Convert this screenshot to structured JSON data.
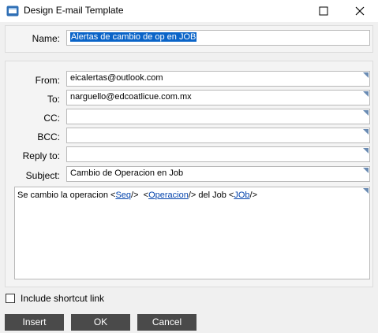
{
  "window": {
    "title": "Design E-mail Template"
  },
  "name": {
    "label": "Name:",
    "value": "Alertas de cambio de op en JOB"
  },
  "fields": {
    "from": {
      "label": "From:",
      "value": "eicalertas@outlook.com"
    },
    "to": {
      "label": "To:",
      "value": "narguello@edcoatlicue.com.mx"
    },
    "cc": {
      "label": "CC:",
      "value": ""
    },
    "bcc": {
      "label": "BCC:",
      "value": ""
    },
    "reply_to": {
      "label": "Reply to:",
      "value": ""
    },
    "subject": {
      "label": "Subject:",
      "value": "Cambio de Operacion en Job"
    }
  },
  "body": {
    "text1": "Se cambio la operacion ",
    "tag1_open": "<",
    "tag1": "Seq",
    "tag1_close": "/>",
    "text2": "  ",
    "tag2_open": "<",
    "tag2": "Operacion",
    "tag2_close": "/>",
    "text3": " del Job ",
    "tag3_open": "<",
    "tag3": "JOb",
    "tag3_close": "/>"
  },
  "options": {
    "include_shortcut_label": "Include shortcut link",
    "include_shortcut_checked": false
  },
  "buttons": {
    "insert": "Insert",
    "ok": "OK",
    "cancel": "Cancel"
  },
  "colors": {
    "button_bg": "#4a4a4a",
    "selection": "#0a64c8",
    "link": "#0645ad",
    "corner_marker": "#6a8bb3"
  }
}
